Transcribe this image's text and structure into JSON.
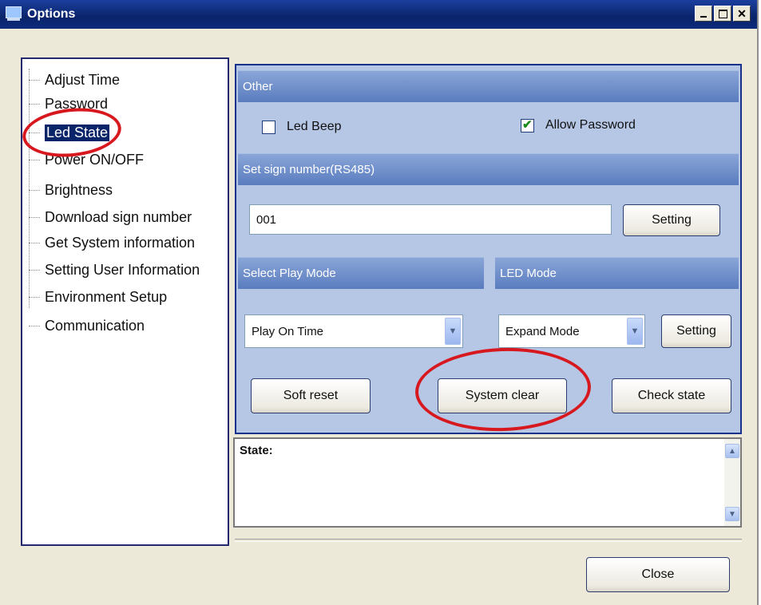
{
  "window": {
    "title": "Options"
  },
  "tree": {
    "items": [
      {
        "label": "Adjust Time",
        "selected": false
      },
      {
        "label": "Password",
        "selected": false
      },
      {
        "label": "Led State",
        "selected": true
      },
      {
        "label": "Power ON/OFF",
        "selected": false
      },
      {
        "label": "Brightness",
        "selected": false
      },
      {
        "label": "Download sign number",
        "selected": false
      },
      {
        "label": "Get System information",
        "selected": false
      },
      {
        "label": "Setting User Information",
        "selected": false
      },
      {
        "label": "Environment Setup",
        "selected": false
      },
      {
        "label": "Communication",
        "selected": false
      }
    ]
  },
  "other": {
    "header": "Other",
    "led_beep": {
      "label": "Led Beep",
      "checked": false
    },
    "allow_password": {
      "label": "Allow Password",
      "checked": true
    }
  },
  "sign_number": {
    "header": "Set sign number(RS485)",
    "value": "001",
    "setting_label": "Setting"
  },
  "play_mode": {
    "header": "Select Play  Mode",
    "selected": "Play On Time"
  },
  "led_mode": {
    "header": "LED Mode",
    "selected": "Expand Mode",
    "setting_label": "Setting"
  },
  "actions": {
    "soft_reset": "Soft reset",
    "system_clear": "System clear",
    "check_state": "Check state"
  },
  "state": {
    "label": "State:"
  },
  "footer": {
    "close_label": "Close"
  },
  "colors": {
    "annotation": "#d7191f",
    "title_bar": "#0a246a",
    "panel": "#b6c7e6"
  }
}
